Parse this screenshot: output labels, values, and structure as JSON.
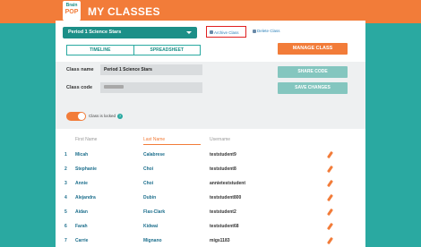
{
  "header": {
    "logo_top": "Brain",
    "logo_bottom": "POP",
    "title": "MY CLASSES"
  },
  "class_select": {
    "value": "Period 1 Science Stars"
  },
  "actions": {
    "archive": "Archive Class",
    "delete": "Delete Class"
  },
  "tabs": [
    {
      "label": "TIMELINE"
    },
    {
      "label": "SPREADSHEET"
    }
  ],
  "manage_button": "MANAGE CLASS",
  "form": {
    "class_name_label": "Class name",
    "class_name_value": "Period 1 Science Stars",
    "class_code_label": "Class code",
    "share_button": "SHARE CODE",
    "save_button": "SAVE CHANGES",
    "locked_label": "Class is locked",
    "info_glyph": "?"
  },
  "table": {
    "headers": {
      "first": "First Name",
      "last": "Last Name",
      "user": "Username"
    },
    "rows": [
      {
        "n": "1",
        "first": "Micah",
        "last": "Calabrese",
        "user": "teststudent9"
      },
      {
        "n": "2",
        "first": "Stephanie",
        "last": "Choi",
        "user": "teststudent8"
      },
      {
        "n": "3",
        "first": "Annie",
        "last": "Choi",
        "user": "annieteststudent"
      },
      {
        "n": "4",
        "first": "Alejandra",
        "last": "Dubin",
        "user": "teststudent800"
      },
      {
        "n": "5",
        "first": "Aidan",
        "last": "Flax-Clark",
        "user": "teststudent2"
      },
      {
        "n": "6",
        "first": "Farah",
        "last": "Kidwai",
        "user": "teststudent68"
      },
      {
        "n": "7",
        "first": "Carrie",
        "last": "Mignano",
        "user": "migs1183"
      }
    ]
  },
  "colors": {
    "teal": "#2aa9a1",
    "orange": "#f27c39",
    "red_highlight": "#e02020"
  }
}
